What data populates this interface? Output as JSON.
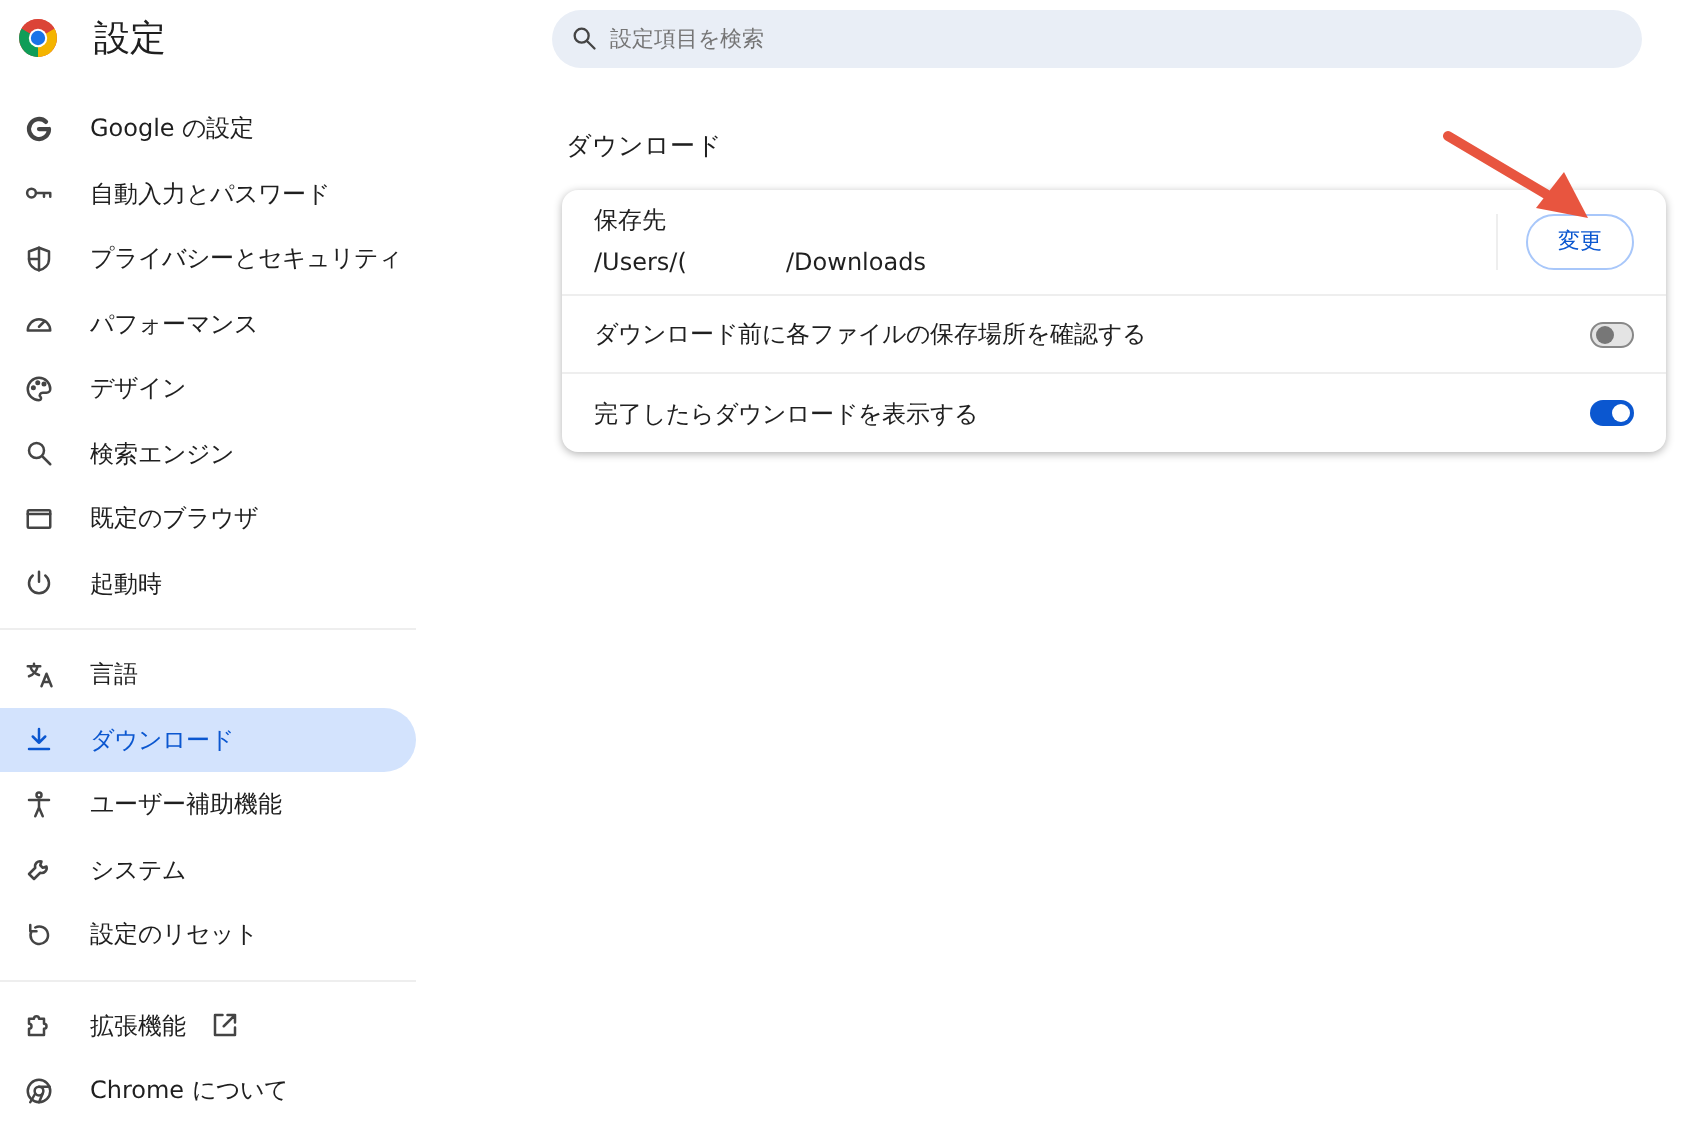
{
  "header": {
    "title": "設定"
  },
  "search": {
    "placeholder": "設定項目を検索"
  },
  "sidebar": {
    "sections": [
      {
        "items": [
          {
            "label": "Google の設定",
            "selected": false,
            "external": false
          },
          {
            "label": "自動入力とパスワード",
            "selected": false,
            "external": false
          },
          {
            "label": "プライバシーとセキュリティ",
            "selected": false,
            "external": false
          },
          {
            "label": "パフォーマンス",
            "selected": false,
            "external": false
          },
          {
            "label": "デザイン",
            "selected": false,
            "external": false
          },
          {
            "label": "検索エンジン",
            "selected": false,
            "external": false
          },
          {
            "label": "既定のブラウザ",
            "selected": false,
            "external": false
          },
          {
            "label": "起動時",
            "selected": false,
            "external": false
          }
        ]
      },
      {
        "items": [
          {
            "label": "言語",
            "selected": false,
            "external": false
          },
          {
            "label": "ダウンロード",
            "selected": true,
            "external": false
          },
          {
            "label": "ユーザー補助機能",
            "selected": false,
            "external": false
          },
          {
            "label": "システム",
            "selected": false,
            "external": false
          },
          {
            "label": "設定のリセット",
            "selected": false,
            "external": false
          }
        ]
      },
      {
        "items": [
          {
            "label": "拡張機能",
            "selected": false,
            "external": true
          },
          {
            "label": "Chrome について",
            "selected": false,
            "external": false
          }
        ]
      }
    ]
  },
  "section": {
    "title": "ダウンロード",
    "location": {
      "label": "保存先",
      "path_start": "/Users/(",
      "path_end": "/Downloads",
      "button": "変更"
    },
    "toggles": [
      {
        "label": "ダウンロード前に各ファイルの保存場所を確認する",
        "on": false
      },
      {
        "label": "完了したらダウンロードを表示する",
        "on": true
      }
    ]
  }
}
